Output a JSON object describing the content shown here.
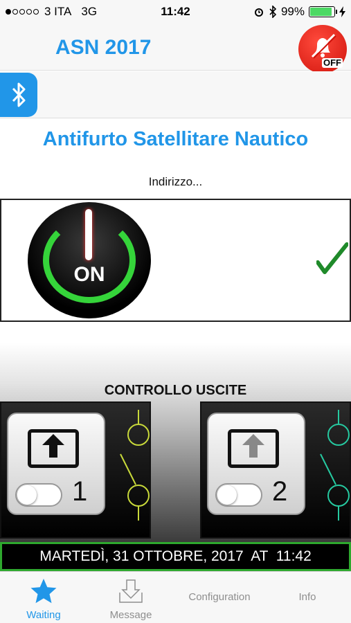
{
  "status_bar": {
    "carrier": "3 ITA",
    "network": "3G",
    "time": "11:42",
    "battery": "99%",
    "battery_level": 0.99
  },
  "header": {
    "title": "ASN 2017",
    "alarm_badge": "OFF",
    "alarm_icon": "bell-slash-icon",
    "accent_color": "#2196e8"
  },
  "bluetooth": {
    "icon": "bluetooth-icon"
  },
  "main": {
    "title": "Antifurto Satellitare Nautico",
    "address": "Indirizzo..."
  },
  "power": {
    "label": "ON",
    "state_icon": "checkmark-icon",
    "ring_color": "#35d43a"
  },
  "outputs": {
    "title": "CONTROLLO USCITE",
    "items": [
      {
        "number": "1",
        "switch_color": "#c8d93a"
      },
      {
        "number": "2",
        "switch_color": "#26c9a0"
      }
    ]
  },
  "date_bar": {
    "text": "MARTEDÌ, 31 OTTOBRE, 2017  AT  11:42"
  },
  "tabs": [
    {
      "label": "Waiting",
      "icon": "star-icon",
      "active": true
    },
    {
      "label": "Message",
      "icon": "inbox-download-icon",
      "active": false
    },
    {
      "label": "Configuration",
      "icon": "",
      "active": false
    },
    {
      "label": "Info",
      "icon": "",
      "active": false
    }
  ]
}
